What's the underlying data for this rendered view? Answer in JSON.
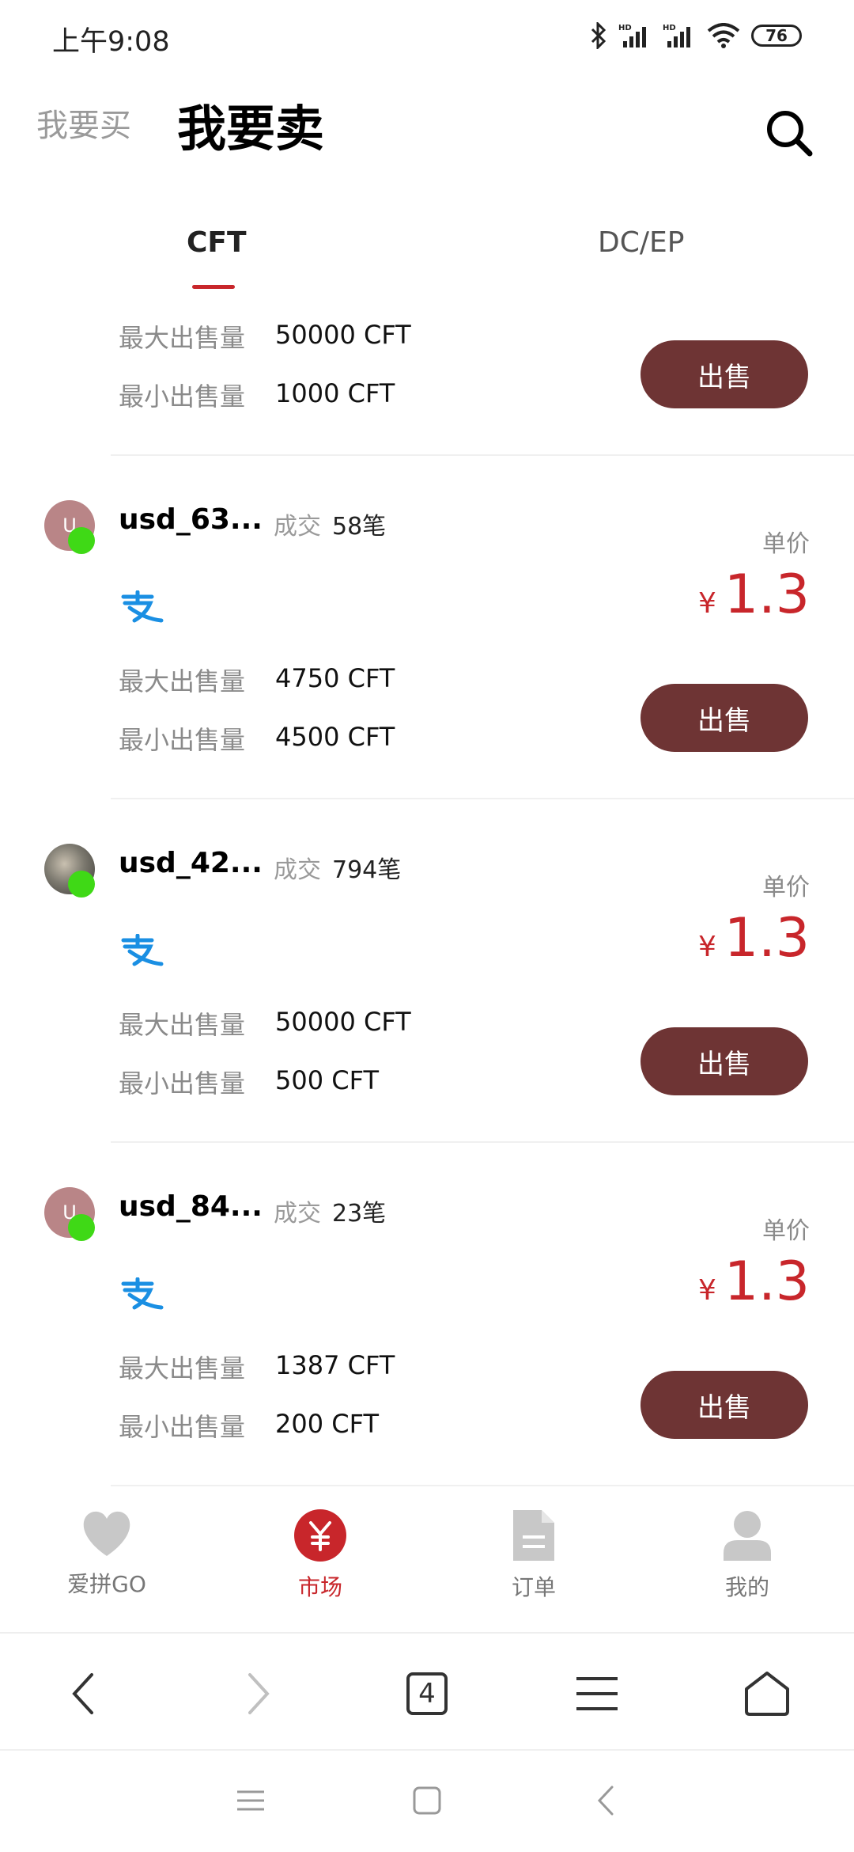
{
  "status_bar": {
    "time": "上午9:08",
    "battery": "76",
    "network": "HD"
  },
  "header": {
    "buy_tab": "我要买",
    "sell_tab": "我要卖"
  },
  "tabs": [
    {
      "label": "CFT",
      "active": true
    },
    {
      "label": "DC/EP",
      "active": false
    }
  ],
  "labels": {
    "max_sell": "最大出售量",
    "min_sell": "最小出售量",
    "trades": "成交",
    "unit_price": "单价",
    "currency": "¥",
    "sell_button": "出售"
  },
  "listings": [
    {
      "max": "50000 CFT",
      "min": "1000 CFT"
    },
    {
      "avatar": "U",
      "username": "usd_63...",
      "trades": "58笔",
      "price": "1.3",
      "max": "4750 CFT",
      "min": "4500 CFT"
    },
    {
      "avatar": "",
      "username": "usd_42...",
      "trades": "794笔",
      "price": "1.3",
      "max": "50000 CFT",
      "min": "500 CFT"
    },
    {
      "avatar": "U",
      "username": "usd_84...",
      "trades": "23笔",
      "price": "1.3",
      "max": "1387 CFT",
      "min": "200 CFT"
    }
  ],
  "bottom_nav": [
    {
      "label": "爱拼GO",
      "icon": "heart-icon",
      "active": false
    },
    {
      "label": "市场",
      "icon": "yuan-icon",
      "active": true
    },
    {
      "label": "订单",
      "icon": "document-icon",
      "active": false
    },
    {
      "label": "我的",
      "icon": "person-icon",
      "active": false
    }
  ],
  "browser": {
    "tab_count": "4"
  },
  "colors": {
    "accent": "#c8262b",
    "button": "#6e3434",
    "online": "#3fd916",
    "alipay": "#1a8fe3"
  }
}
